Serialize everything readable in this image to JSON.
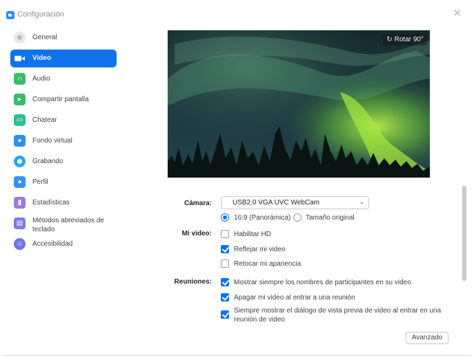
{
  "window": {
    "title": "Configuración",
    "close_icon": "close-icon"
  },
  "sidebar": {
    "items": [
      {
        "label": "General",
        "icon": "gear-icon",
        "active": false
      },
      {
        "label": "Video",
        "icon": "video-camera-icon",
        "active": true
      },
      {
        "label": "Audio",
        "icon": "headphones-icon",
        "active": false
      },
      {
        "label": "Compartir pantalla",
        "icon": "share-screen-icon",
        "active": false
      },
      {
        "label": "Chatear",
        "icon": "chat-bubble-icon",
        "active": false
      },
      {
        "label": "Fondo virtual",
        "icon": "virtual-background-icon",
        "active": false
      },
      {
        "label": "Grabando",
        "icon": "record-icon",
        "active": false
      },
      {
        "label": "Perfil",
        "icon": "profile-icon",
        "active": false
      },
      {
        "label": "Estadísticas",
        "icon": "statistics-icon",
        "active": false
      },
      {
        "label": "Métodos abreviados de teclado",
        "icon": "keyboard-icon",
        "active": false
      },
      {
        "label": "Accesibilidad",
        "icon": "accessibility-icon",
        "active": false
      }
    ]
  },
  "preview": {
    "rotate_label": "Rotar 90°",
    "rotate_icon": "rotate-icon"
  },
  "camera": {
    "label": "Cámara:",
    "selected": "USB2.0 VGA UVC WebCam",
    "ratio_options": [
      {
        "label": "16:9 (Panorámica)",
        "selected": true
      },
      {
        "label": "Tamaño original",
        "selected": false
      }
    ]
  },
  "my_video": {
    "label": "Mi video:",
    "options": [
      {
        "label": "Habilitar HD",
        "checked": false
      },
      {
        "label": "Reflejar mi video",
        "checked": true
      },
      {
        "label": "Retocar mi apariencia",
        "checked": false
      }
    ]
  },
  "meetings": {
    "label": "Reuniones:",
    "options": [
      {
        "label": "Mostrar siempre los nombres de participantes en su video",
        "checked": true
      },
      {
        "label": "Apagar mi video al entrar a una reunión",
        "checked": true
      },
      {
        "label": "Siempre mostrar el diálogo de vista previa de video al entrar en una reunión de video",
        "checked": true
      }
    ]
  },
  "advanced_button": "Avanzado",
  "colors": {
    "accent": "#0e72ed",
    "sidebar_active": "#0e72ed",
    "text": "#232333"
  }
}
